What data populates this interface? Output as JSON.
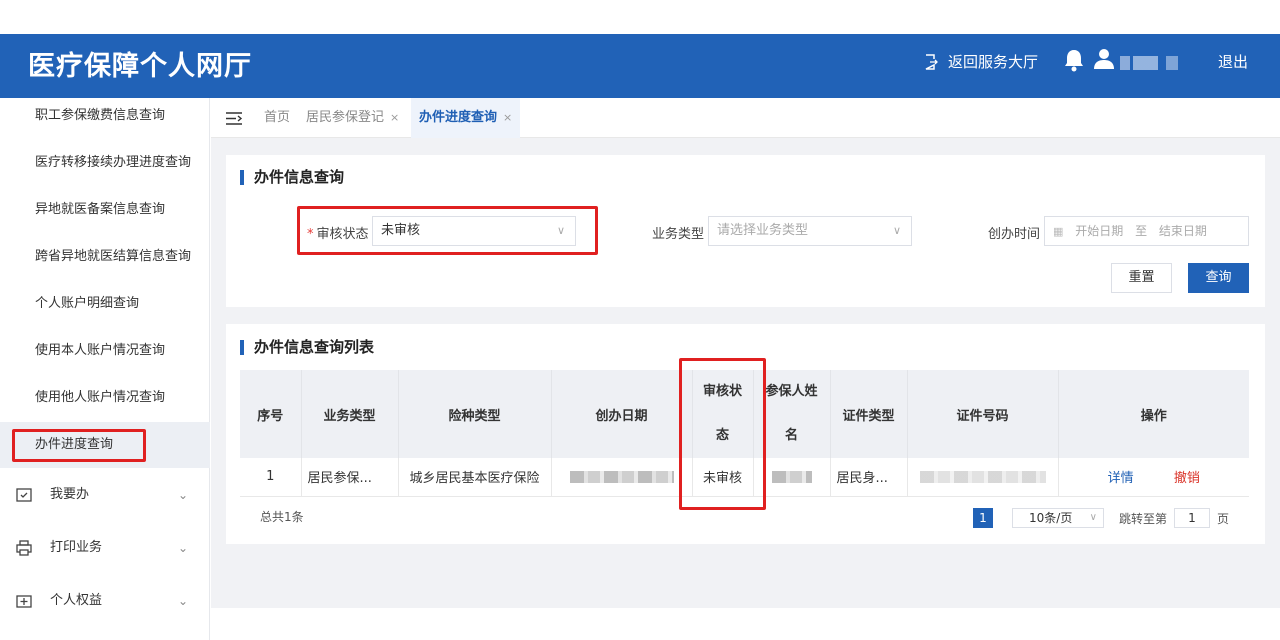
{
  "header": {
    "title": "医疗保障个人网厅",
    "return_label": "返回服务大厅",
    "logout_label": "退出",
    "color": "#2162b7"
  },
  "sidebar": {
    "items": [
      {
        "label": "职工参保缴费信息查询"
      },
      {
        "label": "医疗转移接续办理进度查询"
      },
      {
        "label": "异地就医备案信息查询"
      },
      {
        "label": "跨省异地就医结算信息查询"
      },
      {
        "label": "个人账户明细查询"
      },
      {
        "label": "使用本人账户情况查询"
      },
      {
        "label": "使用他人账户情况查询"
      },
      {
        "label": "办件进度查询"
      }
    ],
    "groups": [
      {
        "label": "我要办",
        "icon": "todo-icon"
      },
      {
        "label": "打印业务",
        "icon": "printer-icon"
      },
      {
        "label": "个人权益",
        "icon": "rights-icon"
      }
    ]
  },
  "tabs": {
    "items": [
      {
        "label": "首页"
      },
      {
        "label": "居民参保登记",
        "close": "×"
      },
      {
        "label": "办件进度查询",
        "close": "×"
      }
    ]
  },
  "search": {
    "title": "办件信息查询",
    "status_required": "*",
    "status_label": "审核状态",
    "status_value": "未审核",
    "business_label": "业务类型",
    "business_placeholder": "请选择业务类型",
    "time_label": "创办时间",
    "start_placeholder": "开始日期",
    "range_sep": "至",
    "end_placeholder": "结束日期",
    "reset_label": "重置",
    "query_label": "查询"
  },
  "list": {
    "title": "办件信息查询列表",
    "columns": [
      "序号",
      "业务类型",
      "险种类型",
      "创办日期",
      "审核状态",
      "参保人姓名",
      "证件类型",
      "证件号码",
      "操作"
    ],
    "rows": [
      {
        "index": "1",
        "business": "居民参保...",
        "insurance": "城乡居民基本医疗保险",
        "status": "未审核",
        "id_type": "居民身...",
        "detail": "详情",
        "revoke": "撤销"
      }
    ],
    "total": "总共1条",
    "page": "1",
    "page_size": "10条/页",
    "jump_label": "跳转至第",
    "jump_value": "1",
    "jump_unit": "页"
  }
}
